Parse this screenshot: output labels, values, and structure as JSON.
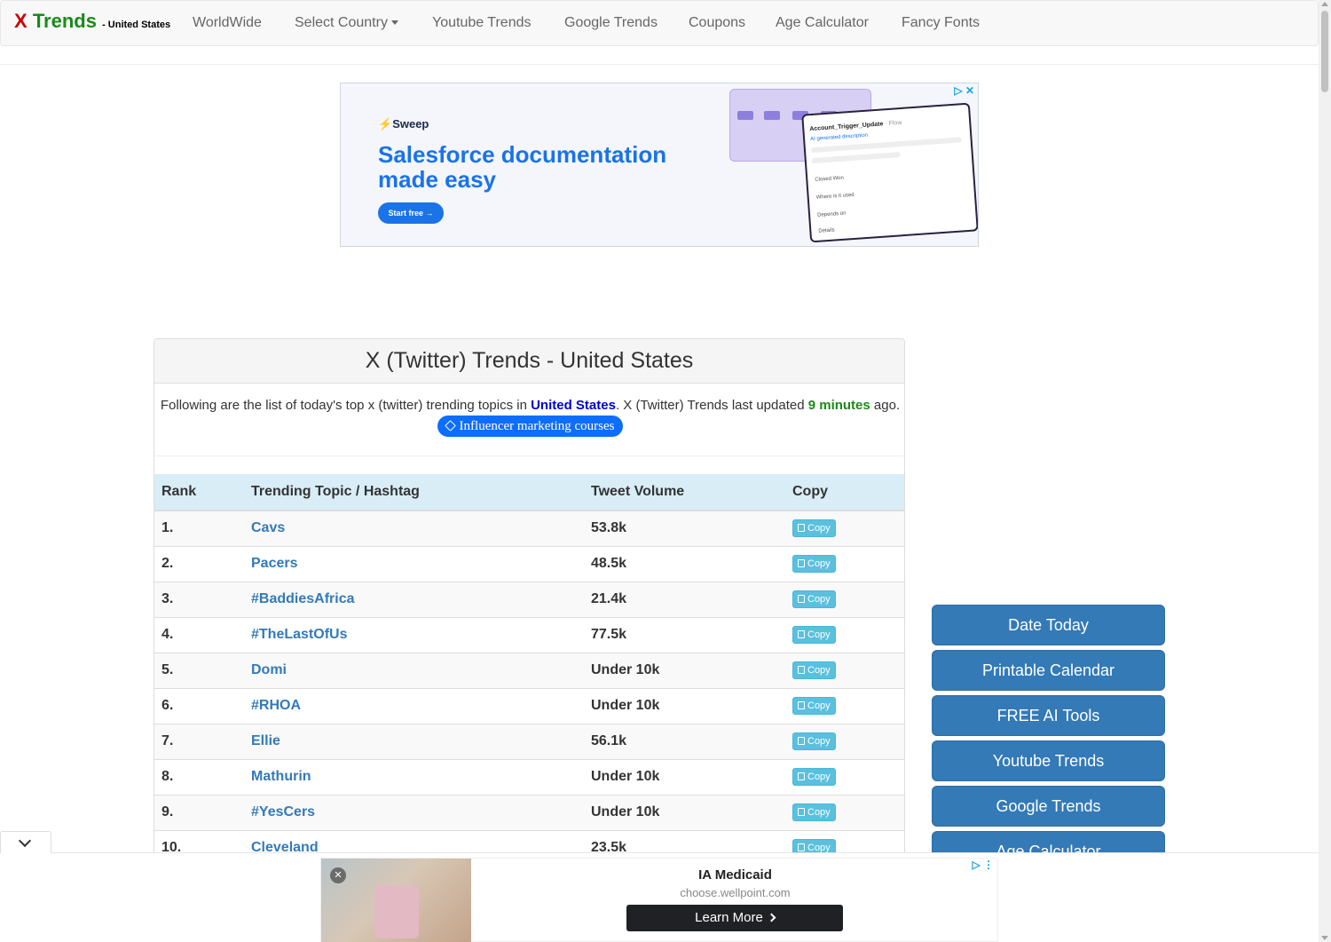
{
  "brand": {
    "x": "X",
    "trends": "Trends",
    "subtitle": "- United States"
  },
  "nav": {
    "worldwide": "WorldWide",
    "select_country": "Select Country",
    "youtube_trends": "Youtube Trends",
    "google_trends": "Google Trends",
    "coupons": "Coupons",
    "age_calculator": "Age Calculator",
    "fancy_fonts": "Fancy Fonts"
  },
  "ad_top": {
    "brand": "Sweep",
    "headline": "Salesforce documentation made easy",
    "cta": "Start free →",
    "card_title": "Account_Trigger_Update",
    "card_suffix": "· Flow",
    "card_desc": "AI generated description",
    "card_rows": [
      "Closed Won",
      "Where is it used",
      "Depends on",
      "Details"
    ]
  },
  "main": {
    "title": "X (Twitter) Trends - United States",
    "intro_prefix": "Following are the list of today's top x (twitter) trending topics in ",
    "intro_country": "United States",
    "intro_middle": ". X (Twitter) Trends last updated ",
    "intro_minutes": "9 minutes",
    "intro_suffix": " ago.",
    "pill_label": "Influencer marketing courses",
    "table": {
      "headers": {
        "rank": "Rank",
        "topic": "Trending Topic / Hashtag",
        "volume": "Tweet Volume",
        "copy": "Copy"
      },
      "copy_label": "Copy",
      "rows": [
        {
          "rank": "1.",
          "topic": "Cavs",
          "volume": "53.8k"
        },
        {
          "rank": "2.",
          "topic": "Pacers",
          "volume": "48.5k"
        },
        {
          "rank": "3.",
          "topic": "#BaddiesAfrica",
          "volume": "21.4k"
        },
        {
          "rank": "4.",
          "topic": "#TheLastOfUs",
          "volume": "77.5k"
        },
        {
          "rank": "5.",
          "topic": "Domi",
          "volume": "Under 10k"
        },
        {
          "rank": "6.",
          "topic": "#RHOA",
          "volume": "Under 10k"
        },
        {
          "rank": "7.",
          "topic": "Ellie",
          "volume": "56.1k"
        },
        {
          "rank": "8.",
          "topic": "Mathurin",
          "volume": "Under 10k"
        },
        {
          "rank": "9.",
          "topic": "#YesCers",
          "volume": "Under 10k"
        },
        {
          "rank": "10.",
          "topic": "Cleveland",
          "volume": "23.5k"
        }
      ]
    }
  },
  "sidebar": {
    "buttons": [
      "Date Today",
      "Printable Calendar",
      "FREE AI Tools",
      "Youtube Trends",
      "Google Trends",
      "Age Calculator"
    ]
  },
  "ad_bottom": {
    "title": "IA Medicaid",
    "url": "choose.wellpoint.com",
    "cta": "Learn More"
  },
  "colors": {
    "brand_x": "#cc0000",
    "brand_trends": "#1a8a1a",
    "link_blue": "#337ab7",
    "sidebar_button": "#337ab7",
    "copy_button": "#5bc0de",
    "table_header": "#d9edf7",
    "pill": "#0d6efd"
  },
  "icons": [
    "tag-icon",
    "copy-icon",
    "chevron-down-icon",
    "ad-choices-icon",
    "mute-icon",
    "chevron-right-icon",
    "caret-down-icon"
  ]
}
